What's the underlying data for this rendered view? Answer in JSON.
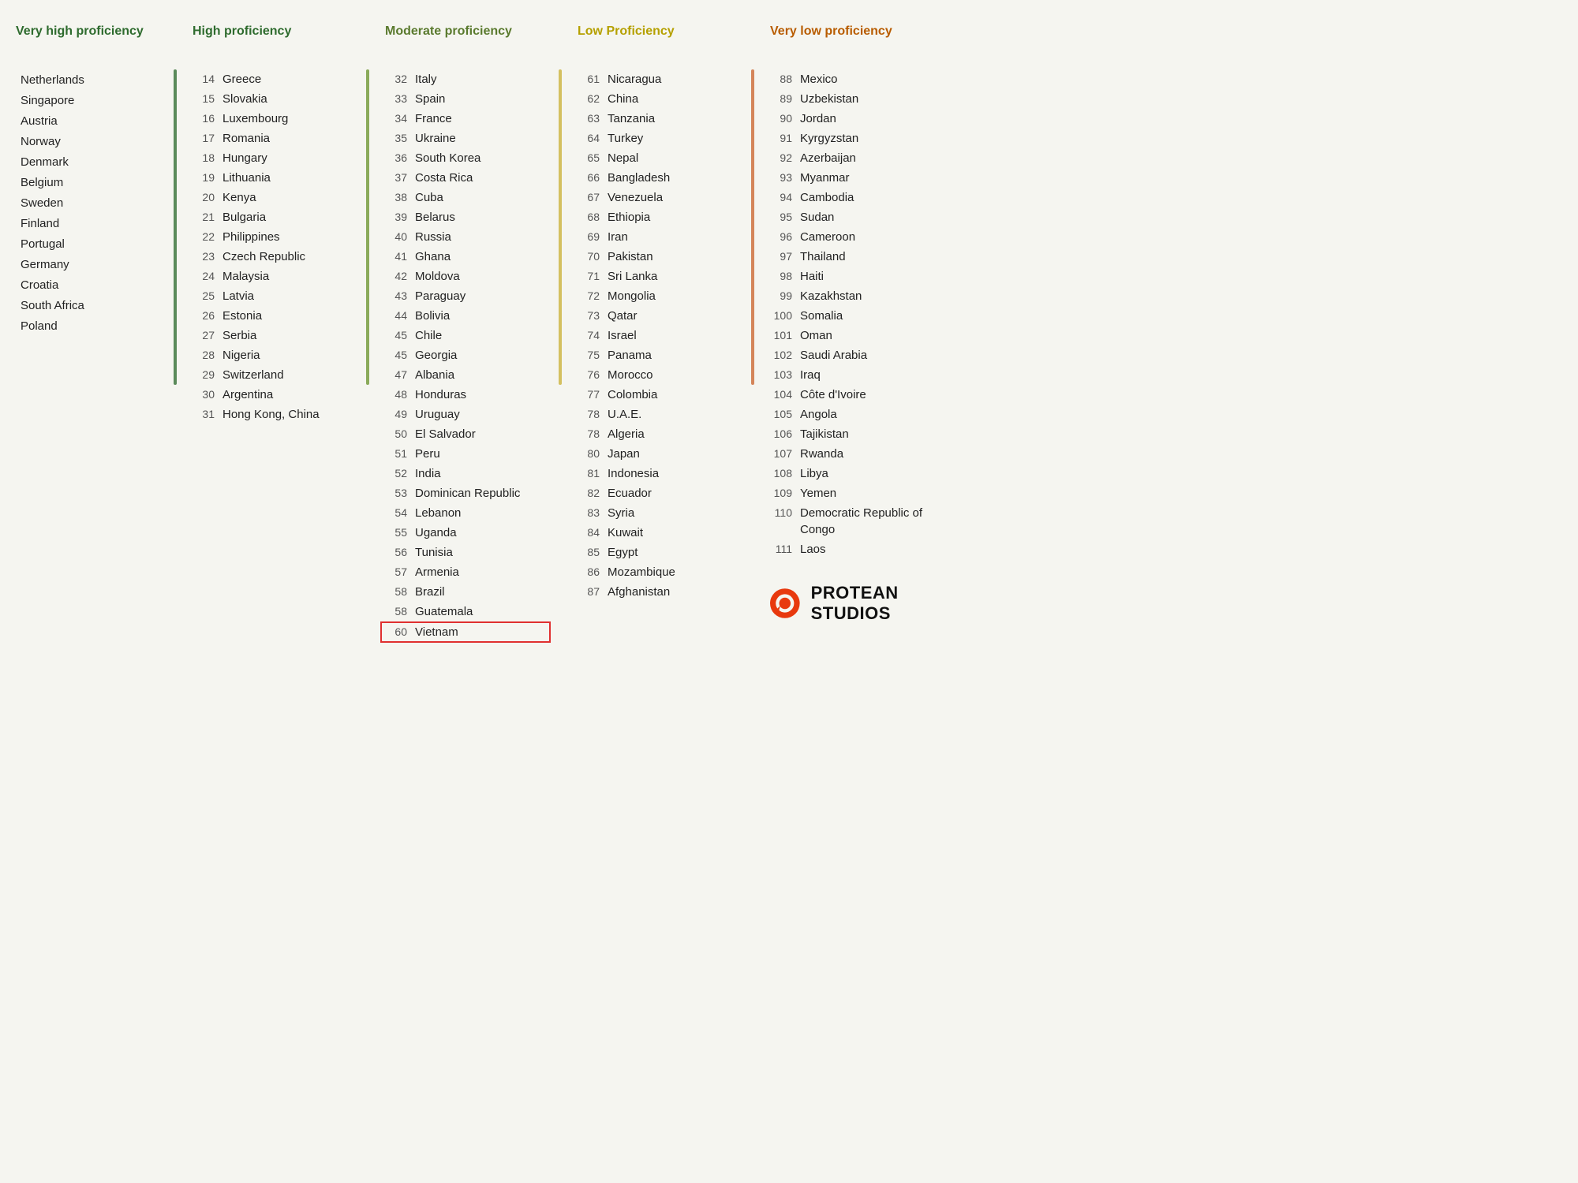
{
  "columns": {
    "veryHigh": {
      "header": "Very high proficiency",
      "headerColor": "#2e6b2e",
      "items": [
        {
          "country": "Netherlands"
        },
        {
          "country": "Singapore"
        },
        {
          "country": "Austria"
        },
        {
          "country": "Norway"
        },
        {
          "country": "Denmark"
        },
        {
          "country": "Belgium"
        },
        {
          "country": "Sweden"
        },
        {
          "country": "Finland"
        },
        {
          "country": "Portugal"
        },
        {
          "country": "Germany"
        },
        {
          "country": "Croatia"
        },
        {
          "country": "South Africa"
        },
        {
          "country": "Poland"
        }
      ]
    },
    "high": {
      "header": "High proficiency",
      "items": [
        {
          "rank": 14,
          "country": "Greece"
        },
        {
          "rank": 15,
          "country": "Slovakia"
        },
        {
          "rank": 16,
          "country": "Luxembourg"
        },
        {
          "rank": 17,
          "country": "Romania"
        },
        {
          "rank": 18,
          "country": "Hungary"
        },
        {
          "rank": 19,
          "country": "Lithuania"
        },
        {
          "rank": 20,
          "country": "Kenya"
        },
        {
          "rank": 21,
          "country": "Bulgaria"
        },
        {
          "rank": 22,
          "country": "Philippines"
        },
        {
          "rank": 23,
          "country": "Czech Republic"
        },
        {
          "rank": 24,
          "country": "Malaysia"
        },
        {
          "rank": 25,
          "country": "Latvia"
        },
        {
          "rank": 26,
          "country": "Estonia"
        },
        {
          "rank": 27,
          "country": "Serbia"
        },
        {
          "rank": 28,
          "country": "Nigeria"
        },
        {
          "rank": 29,
          "country": "Switzerland"
        },
        {
          "rank": 30,
          "country": "Argentina"
        },
        {
          "rank": 31,
          "country": "Hong Kong, China"
        }
      ]
    },
    "moderate": {
      "header": "Moderate proficiency",
      "items": [
        {
          "rank": 32,
          "country": "Italy"
        },
        {
          "rank": 33,
          "country": "Spain"
        },
        {
          "rank": 34,
          "country": "France"
        },
        {
          "rank": 35,
          "country": "Ukraine"
        },
        {
          "rank": 36,
          "country": "South Korea"
        },
        {
          "rank": 37,
          "country": "Costa Rica"
        },
        {
          "rank": 38,
          "country": "Cuba"
        },
        {
          "rank": 39,
          "country": "Belarus"
        },
        {
          "rank": 40,
          "country": "Russia"
        },
        {
          "rank": 41,
          "country": "Ghana"
        },
        {
          "rank": 42,
          "country": "Moldova"
        },
        {
          "rank": 43,
          "country": "Paraguay"
        },
        {
          "rank": 44,
          "country": "Bolivia"
        },
        {
          "rank": 45,
          "country": "Chile"
        },
        {
          "rank": 45,
          "country": "Georgia"
        },
        {
          "rank": 47,
          "country": "Albania"
        },
        {
          "rank": 48,
          "country": "Honduras"
        },
        {
          "rank": 49,
          "country": "Uruguay"
        },
        {
          "rank": 50,
          "country": "El Salvador"
        },
        {
          "rank": 51,
          "country": "Peru"
        },
        {
          "rank": 52,
          "country": "India"
        },
        {
          "rank": 53,
          "country": "Dominican Republic"
        },
        {
          "rank": 54,
          "country": "Lebanon"
        },
        {
          "rank": 55,
          "country": "Uganda"
        },
        {
          "rank": 56,
          "country": "Tunisia"
        },
        {
          "rank": 57,
          "country": "Armenia"
        },
        {
          "rank": 58,
          "country": "Brazil"
        },
        {
          "rank": 58,
          "country": "Guatemala"
        },
        {
          "rank": 60,
          "country": "Vietnam",
          "highlighted": true
        }
      ]
    },
    "low": {
      "header": "Low Proficiency",
      "items": [
        {
          "rank": 61,
          "country": "Nicaragua"
        },
        {
          "rank": 62,
          "country": "China"
        },
        {
          "rank": 63,
          "country": "Tanzania"
        },
        {
          "rank": 64,
          "country": "Turkey"
        },
        {
          "rank": 65,
          "country": "Nepal"
        },
        {
          "rank": 66,
          "country": "Bangladesh"
        },
        {
          "rank": 67,
          "country": "Venezuela"
        },
        {
          "rank": 68,
          "country": "Ethiopia"
        },
        {
          "rank": 69,
          "country": "Iran"
        },
        {
          "rank": 70,
          "country": "Pakistan"
        },
        {
          "rank": 71,
          "country": "Sri Lanka"
        },
        {
          "rank": 72,
          "country": "Mongolia"
        },
        {
          "rank": 73,
          "country": "Qatar"
        },
        {
          "rank": 74,
          "country": "Israel"
        },
        {
          "rank": 75,
          "country": "Panama"
        },
        {
          "rank": 76,
          "country": "Morocco"
        },
        {
          "rank": 77,
          "country": "Colombia"
        },
        {
          "rank": 78,
          "country": "U.A.E."
        },
        {
          "rank": 78,
          "country": "Algeria"
        },
        {
          "rank": 80,
          "country": "Japan"
        },
        {
          "rank": 81,
          "country": "Indonesia"
        },
        {
          "rank": 82,
          "country": "Ecuador"
        },
        {
          "rank": 83,
          "country": "Syria"
        },
        {
          "rank": 84,
          "country": "Kuwait"
        },
        {
          "rank": 85,
          "country": "Egypt"
        },
        {
          "rank": 86,
          "country": "Mozambique"
        },
        {
          "rank": 87,
          "country": "Afghanistan"
        }
      ]
    },
    "veryLow": {
      "header": "Very low proficiency",
      "items": [
        {
          "rank": 88,
          "country": "Mexico"
        },
        {
          "rank": 89,
          "country": "Uzbekistan"
        },
        {
          "rank": 90,
          "country": "Jordan"
        },
        {
          "rank": 91,
          "country": "Kyrgyzstan"
        },
        {
          "rank": 92,
          "country": "Azerbaijan"
        },
        {
          "rank": 93,
          "country": "Myanmar"
        },
        {
          "rank": 94,
          "country": "Cambodia"
        },
        {
          "rank": 95,
          "country": "Sudan"
        },
        {
          "rank": 96,
          "country": "Cameroon"
        },
        {
          "rank": 97,
          "country": "Thailand"
        },
        {
          "rank": 98,
          "country": "Haiti"
        },
        {
          "rank": 99,
          "country": "Kazakhstan"
        },
        {
          "rank": 100,
          "country": "Somalia"
        },
        {
          "rank": 101,
          "country": "Oman"
        },
        {
          "rank": 102,
          "country": "Saudi Arabia"
        },
        {
          "rank": 103,
          "country": "Iraq"
        },
        {
          "rank": 104,
          "country": "Côte d'Ivoire"
        },
        {
          "rank": 105,
          "country": "Angola"
        },
        {
          "rank": 106,
          "country": "Tajikistan"
        },
        {
          "rank": 107,
          "country": "Rwanda"
        },
        {
          "rank": 108,
          "country": "Libya"
        },
        {
          "rank": 109,
          "country": "Yemen"
        },
        {
          "rank": 110,
          "country": "Democratic Republic of Congo"
        },
        {
          "rank": 111,
          "country": "Laos"
        }
      ]
    }
  },
  "logo": {
    "text": "PROTEAN STUDIOS"
  }
}
